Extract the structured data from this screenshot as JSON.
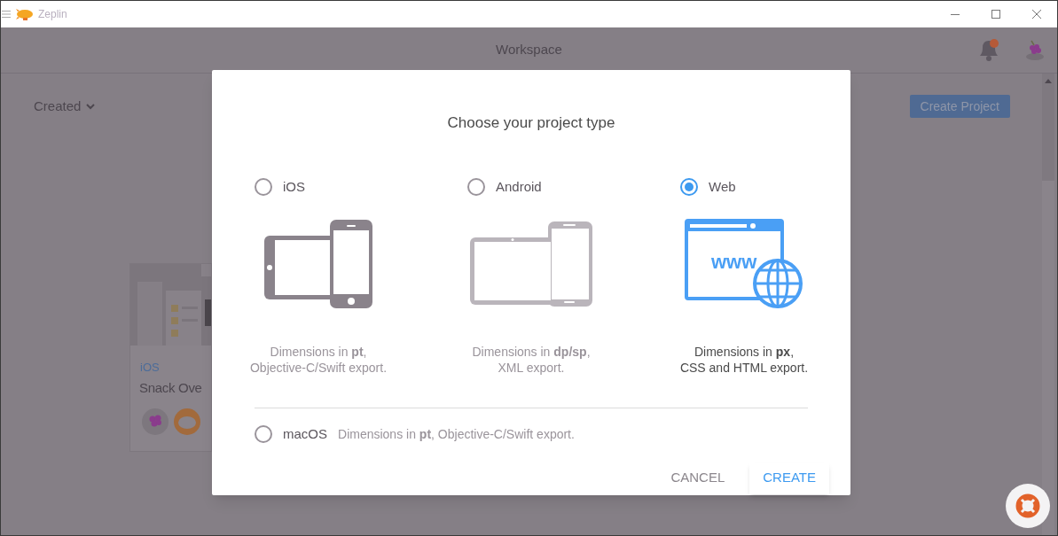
{
  "window": {
    "title": "Zeplin"
  },
  "header": {
    "title": "Workspace"
  },
  "toolbar": {
    "filter": "Created",
    "create_button": "Create Project"
  },
  "projects": [
    {
      "platform": "iOS",
      "name": "Snack Ove"
    }
  ],
  "dialog": {
    "title": "Choose your project type",
    "options": [
      {
        "kind": "ios",
        "label": "iOS",
        "description": [
          "Dimensions in **pt**,",
          "Objective-C/Swift export."
        ],
        "selected": false
      },
      {
        "kind": "android",
        "label": "Android",
        "description": [
          "Dimensions in **dp/sp**,",
          "XML export."
        ],
        "selected": false
      },
      {
        "kind": "web",
        "label": "Web",
        "icon_text": "www",
        "description": [
          "Dimensions in **px**,",
          "CSS and HTML export."
        ],
        "selected": true
      }
    ],
    "extra_option": {
      "label": "macOS",
      "description": "Dimensions in **pt**, Objective-C/Swift export.",
      "selected": false
    },
    "buttons": {
      "cancel": "CANCEL",
      "create": "CREATE"
    }
  }
}
